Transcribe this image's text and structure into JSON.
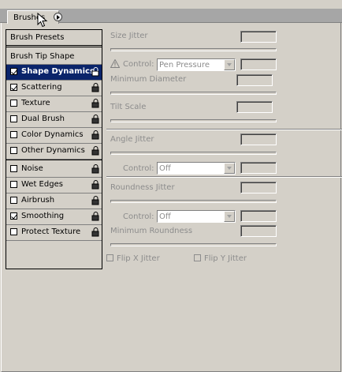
{
  "tab": {
    "label": "Brushes"
  },
  "left_panel": {
    "brush_presets": "Brush Presets",
    "brush_tip_shape": "Brush Tip Shape",
    "items": [
      {
        "label": "Shape Dynamics",
        "checked": true,
        "selected": true
      },
      {
        "label": "Scattering",
        "checked": true
      },
      {
        "label": "Texture",
        "checked": false
      },
      {
        "label": "Dual Brush",
        "checked": false
      },
      {
        "label": "Color Dynamics",
        "checked": false
      },
      {
        "label": "Other Dynamics",
        "checked": false
      },
      {
        "label": "Noise",
        "checked": false
      },
      {
        "label": "Wet Edges",
        "checked": false
      },
      {
        "label": "Airbrush",
        "checked": false
      },
      {
        "label": "Smoothing",
        "checked": true
      },
      {
        "label": "Protect Texture",
        "checked": false
      }
    ]
  },
  "right_panel": {
    "size_jitter": "Size Jitter",
    "control_label": "Control:",
    "size_control_value": "Pen Pressure",
    "minimum_diameter": "Minimum Diameter",
    "tilt_scale": "Tilt Scale",
    "angle_jitter": "Angle Jitter",
    "angle_control_value": "Off",
    "roundness_jitter": "Roundness Jitter",
    "roundness_control_value": "Off",
    "minimum_roundness": "Minimum Roundness",
    "flip_x": "Flip X Jitter",
    "flip_y": "Flip Y Jitter"
  },
  "colors": {
    "selected_bg": "#0a246a",
    "panel_bg": "#d4d0c8",
    "disabled_text": "#8c8c8c"
  },
  "icons": {
    "lock": "lock-icon",
    "warning": "warning-icon",
    "menu_arrow": "panel-menu-arrow-icon"
  }
}
